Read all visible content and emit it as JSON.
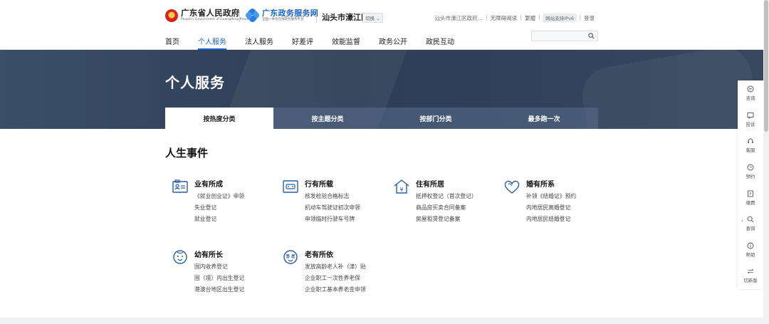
{
  "header": {
    "logo1_main": "广东省人民政府",
    "logo1_sub": "People's Government of Guangdong Province",
    "logo2_main": "广东政务服务网",
    "logo2_sub": "全国一体化在线政务服务平台",
    "city": "汕头市濠江区",
    "switch_label": "切换",
    "top_links": {
      "gov": "汕头市濠江区政府...",
      "accessible": "无障碍阅读",
      "traditional": "繁體",
      "ipv6": "网站支持IPv6",
      "login": "登录"
    },
    "search_placeholder": ""
  },
  "nav": [
    "首页",
    "个人服务",
    "法人服务",
    "好差评",
    "效能监督",
    "政务公开",
    "政民互动"
  ],
  "nav_active": "个人服务",
  "banner": {
    "title": "个人服务"
  },
  "tabs": [
    "按热度分类",
    "按主题分类",
    "按部门分类",
    "最多跑一次"
  ],
  "tab_active": "按热度分类",
  "section_title": "人生事件",
  "categories": [
    {
      "icon": "id-card-icon",
      "title": "业有所成",
      "items": [
        "《就业创业证》申领",
        "失业登记",
        "就业登记"
      ]
    },
    {
      "icon": "car-icon",
      "title": "行有所载",
      "items": [
        "核发检验合格标志",
        "机动车驾驶证初次申领",
        "申领临时行驶车号牌"
      ]
    },
    {
      "icon": "house-icon",
      "title": "住有所居",
      "items": [
        "抵押权登记（首次登记）",
        "商品房买卖合同备案",
        "房屋租赁登记备案"
      ]
    },
    {
      "icon": "heart-icon",
      "title": "婚有所系",
      "items": [
        "补领《结婚证》预约",
        "内地居民离婚登记",
        "内地居民结婚登记"
      ]
    },
    {
      "icon": "baby-icon",
      "title": "幼有所长",
      "items": [
        "国内收养登记",
        "国（境）内出生登记",
        "港澳台地区出生登记"
      ]
    },
    {
      "icon": "elder-icon",
      "title": "老有所依",
      "items": [
        "发放高龄老人补（津）贴",
        "企业职工一次性养老保",
        "企业职工基本养老金申领"
      ]
    }
  ],
  "sidebar": [
    {
      "icon": "chat-icon",
      "label": "咨询"
    },
    {
      "icon": "complaint-icon",
      "label": "投诉"
    },
    {
      "icon": "headset-icon",
      "label": "客服"
    },
    {
      "icon": "clock-icon",
      "label": "预约"
    },
    {
      "icon": "payment-icon",
      "label": "缴费"
    },
    {
      "icon": "search-icon",
      "label": "查询"
    },
    {
      "icon": "info-icon",
      "label": "帮助"
    },
    {
      "icon": "switch-icon",
      "label": "切新版"
    }
  ],
  "colors": {
    "brand_blue": "#1a64c8",
    "banner_bg": "#2c3d55",
    "icon_blue": "#2a5da8"
  }
}
